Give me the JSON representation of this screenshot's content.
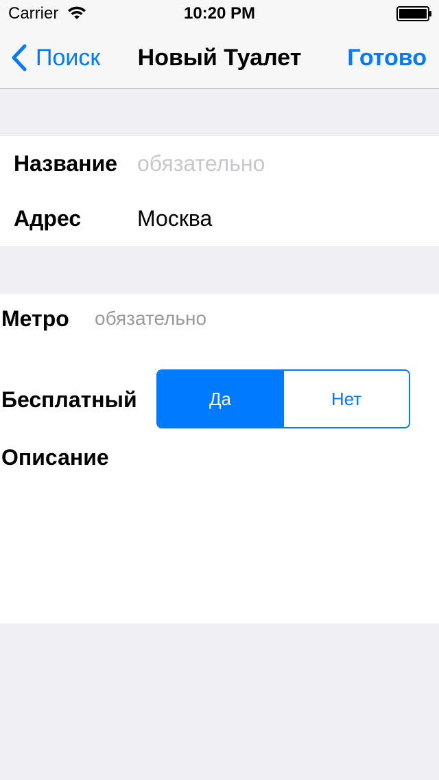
{
  "status_bar": {
    "carrier": "Carrier",
    "time": "10:20 PM"
  },
  "nav": {
    "back_label": "Поиск",
    "title": "Новый Туалет",
    "done_label": "Готово"
  },
  "colors": {
    "accent": "#007aff",
    "background": "#efeff4",
    "placeholder": "#c7c7cd"
  },
  "form": {
    "name": {
      "label": "Название",
      "placeholder": "обязательно",
      "value": ""
    },
    "address": {
      "label": "Адрес",
      "value": "Москва"
    },
    "metro": {
      "label": "Метро",
      "placeholder": "обязательно",
      "value": ""
    },
    "free": {
      "label": "Бесплатный",
      "options": [
        "Да",
        "Нет"
      ],
      "selected": "Да"
    },
    "description": {
      "label": "Описание",
      "value": ""
    }
  }
}
